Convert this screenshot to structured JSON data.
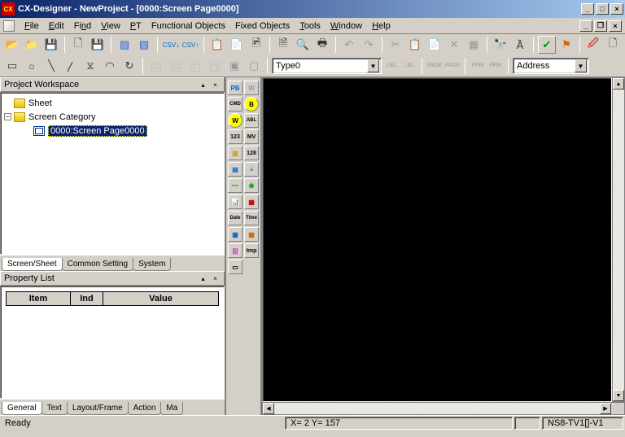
{
  "window": {
    "app_name": "CX-Designer",
    "project": "NewProject",
    "screen": "[0000:Screen Page0000]",
    "title_sep": " - "
  },
  "menu": {
    "file": "File",
    "edit": "Edit",
    "find": "Find",
    "view": "View",
    "pt": "PT",
    "functional_objects": "Functional Objects",
    "fixed_objects": "Fixed Objects",
    "tools": "Tools",
    "window": "Window",
    "help": "Help"
  },
  "toolbar2": {
    "type_combo": "Type0",
    "address_combo": "Address",
    "lbl1": "LBL",
    "lbl2": "LBL",
    "page1": "PAGE",
    "page2": "PAGE",
    "frm1": "FRM",
    "frm2": "FRM"
  },
  "workspace": {
    "title": "Project Workspace",
    "sheet": "Sheet",
    "category": "Screen Category",
    "page": "0000:Screen Page0000",
    "tabs": {
      "screen": "Screen/Sheet",
      "common": "Common Setting",
      "system": "System"
    }
  },
  "proplist": {
    "title": "Property List",
    "col_item": "Item",
    "col_ind": "Ind",
    "col_value": "Value",
    "tabs": {
      "general": "General",
      "text": "Text",
      "layout": "Layout/Frame",
      "action": "Action",
      "more": "Ma"
    }
  },
  "palette": {
    "r0a": "PB",
    "r0b": "W",
    "r1a": "CMD",
    "r1b": "B",
    "r2a": "W",
    "r2b": "ABL",
    "r3a": "123",
    "r3b": "MV",
    "r4a": "▥",
    "r4b": "128",
    "r5a": "▤",
    "r5b": "≡",
    "r6a": "〰",
    "r6b": "❀",
    "r7a": "📊",
    "r7b": "▦",
    "r8a": "Date",
    "r8b": "Time",
    "r9a": "▦",
    "r9b": "▦",
    "r10a": "|||",
    "r10b": "tmp",
    "r11a": "▭",
    "r11b": ""
  },
  "status": {
    "ready": "Ready",
    "coords": "X=   2 Y= 157",
    "model": "NS8-TV1[]-V1"
  }
}
